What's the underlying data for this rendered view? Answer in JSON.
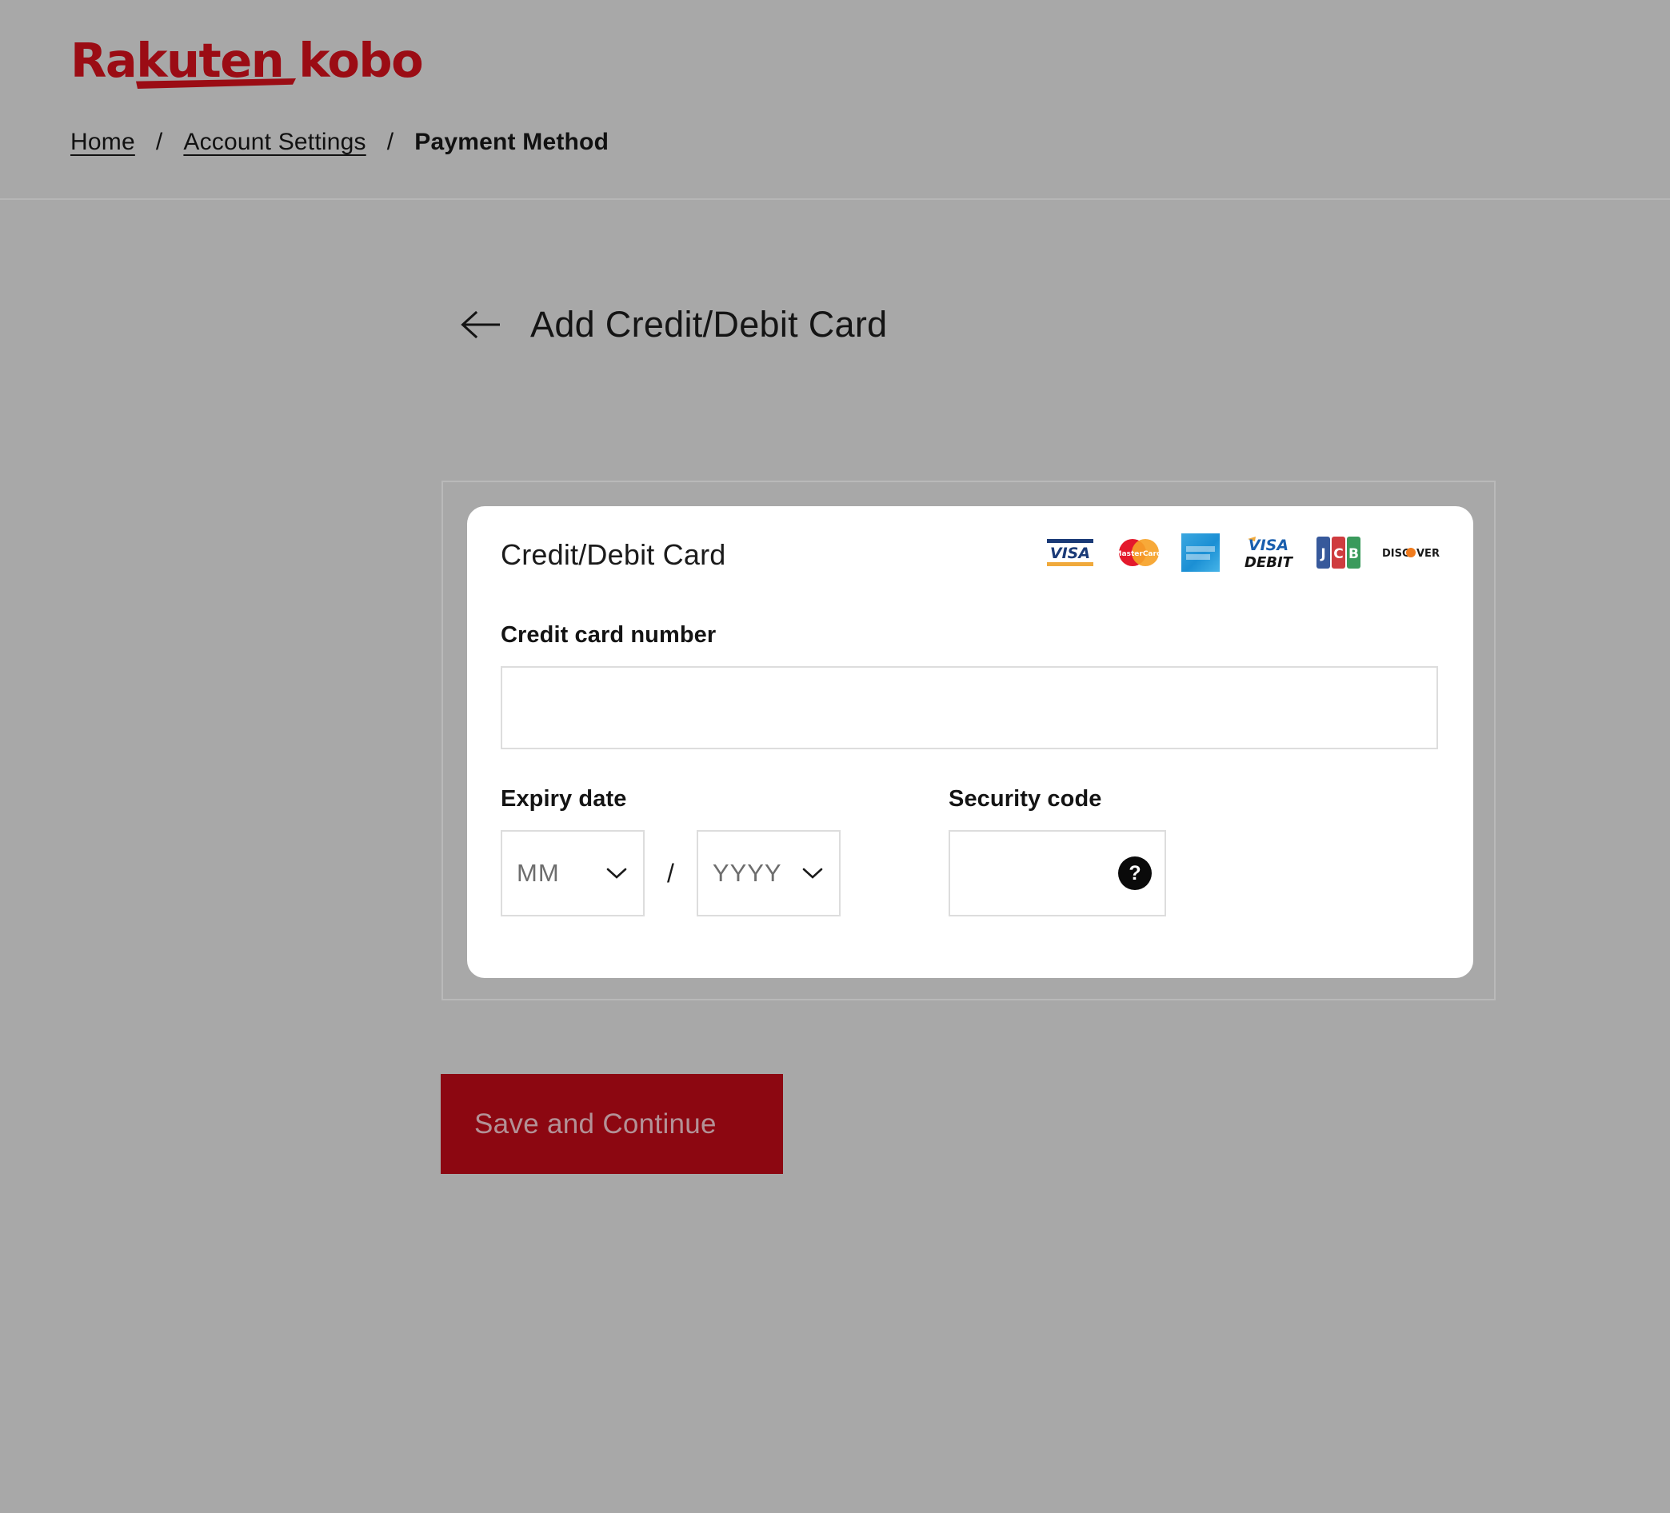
{
  "brand": {
    "name": "Rakuten kobo",
    "color": "#9b0c14"
  },
  "breadcrumb": {
    "items": [
      {
        "label": "Home",
        "current": false
      },
      {
        "label": "Account Settings",
        "current": false
      },
      {
        "label": "Payment Method",
        "current": true
      }
    ],
    "separator": "/"
  },
  "page": {
    "title": "Add Credit/Debit Card",
    "back_icon": "arrow-left-icon"
  },
  "card_panel": {
    "title": "Credit/Debit Card",
    "accepted_brands": [
      {
        "name": "VISA",
        "icon": "visa-logo"
      },
      {
        "name": "MasterCard",
        "icon": "mastercard-logo"
      },
      {
        "name": "AMERICAN EXPRESS",
        "icon": "amex-logo"
      },
      {
        "name": "VISA DEBIT",
        "icon": "visa-debit-logo"
      },
      {
        "name": "JCB",
        "icon": "jcb-logo"
      },
      {
        "name": "DISCOVER",
        "icon": "discover-logo"
      }
    ],
    "credit_card_number": {
      "label": "Credit card number",
      "value": "",
      "placeholder": ""
    },
    "expiry": {
      "label": "Expiry date",
      "month_value": "MM",
      "year_value": "YYYY",
      "separator": "/"
    },
    "security": {
      "label": "Security code",
      "value": "",
      "placeholder": "",
      "help_glyph": "?"
    }
  },
  "actions": {
    "save_label": "Save and Continue",
    "save_bg": "#8c0711"
  }
}
